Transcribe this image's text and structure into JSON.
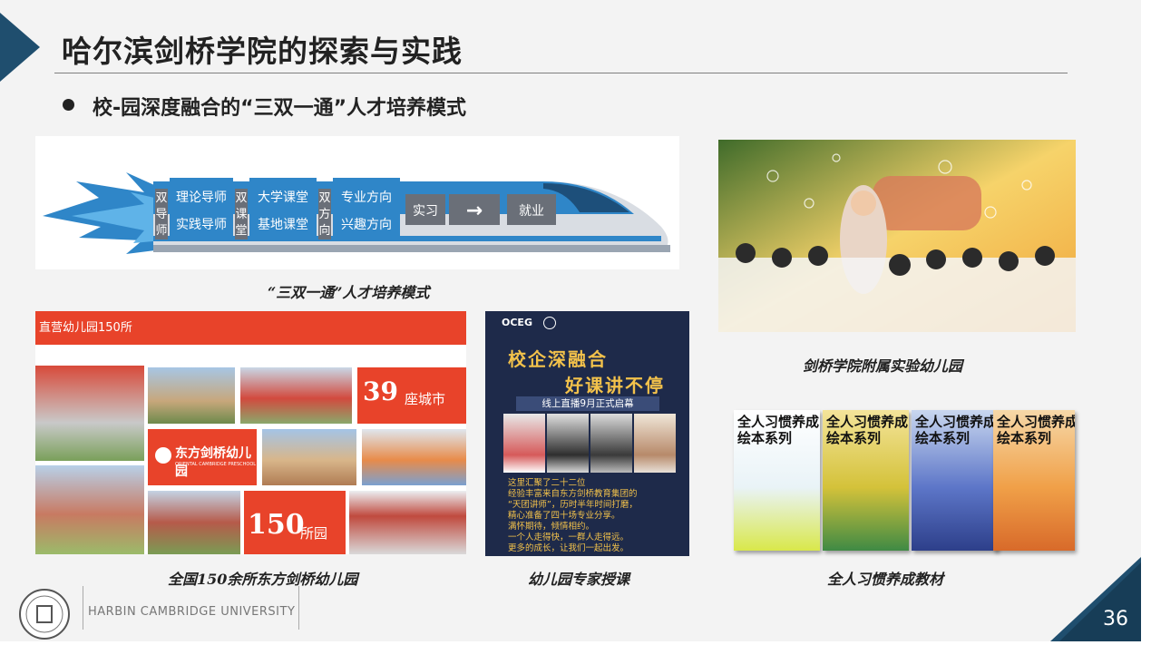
{
  "slide": {
    "title": "哈尔滨剑桥学院的探索与实践",
    "subtitle": "校-园深度融合的“三双一通”人才培养模式",
    "page_number": "36",
    "footer_text": "HARBIN CAMBRIDGE  UNIVERSITY"
  },
  "train": {
    "label1": [
      "双",
      "导",
      "师"
    ],
    "box1": [
      "理论导师",
      "实践导师"
    ],
    "label2": [
      "双",
      "课",
      "堂"
    ],
    "box2": [
      "大学课堂",
      "基地课堂"
    ],
    "label3": [
      "双",
      "方",
      "向"
    ],
    "box3": [
      "专业方向",
      "兴趣方向"
    ],
    "step1": "实习",
    "arrow": "→",
    "step2": "就业",
    "caption": "“三双一通”人才培养模式"
  },
  "kindergarten": {
    "header": "直营幼儿园150所",
    "badge_cities_num": "39",
    "badge_cities_unit": "座城市",
    "badge_kg_num": "150",
    "badge_kg_unit": "所园",
    "brand_name": "东方剑桥幼儿园",
    "brand_sub": "ORIENTAL CAMBRIDGE PRESCHOOL",
    "caption": "全国150余所东方剑桥幼儿园"
  },
  "poster": {
    "logo_text": "OCEG",
    "headline1": "校企深融合",
    "headline2": "好课讲不停",
    "band": "线上直播9月正式启幕",
    "body": [
      "这里汇聚了二十二位",
      "经验丰富来自东方剑桥教育集团的",
      "“天团讲师”，历时半年时间打磨，",
      "精心准备了四十场专业分享。",
      "满怀期待，倾情相约。",
      "一个人走得快，一群人走得远。",
      "更多的成长，让我们一起出发。"
    ],
    "caption": "幼儿园专家授课"
  },
  "kids": {
    "caption": "剑桥学院附属实验幼儿园"
  },
  "books": {
    "title_line1": "全人习惯养成",
    "title_line2": "绘本系列",
    "caption": "全人习惯养成教材"
  },
  "colors": {
    "accent_navy": "#1f4e6e",
    "train_blue": "#3d8fd1",
    "badge_red": "#e8432a",
    "poster_navy": "#1e2a4a",
    "poster_gold": "#f3c24b"
  }
}
